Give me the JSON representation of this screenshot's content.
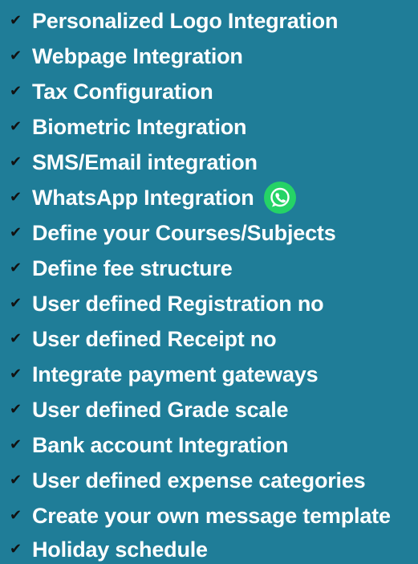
{
  "colors": {
    "background": "#1f7d98",
    "text": "#ffffff",
    "check": "#111111",
    "whatsapp_green": "#25d366"
  },
  "icons": {
    "bullet": "check-icon",
    "whatsapp": "whatsapp-icon"
  },
  "features": [
    {
      "label": "Personalized Logo Integration"
    },
    {
      "label": "Webpage Integration"
    },
    {
      "label": "Tax Configuration"
    },
    {
      "label": "Biometric Integration"
    },
    {
      "label": "SMS/Email integration"
    },
    {
      "label": "WhatsApp Integration"
    },
    {
      "label": "Define your Courses/Subjects"
    },
    {
      "label": "Define fee structure"
    },
    {
      "label": "User defined Registration no"
    },
    {
      "label": "User defined Receipt no"
    },
    {
      "label": "Integrate payment gateways"
    },
    {
      "label": "User defined Grade scale"
    },
    {
      "label": "Bank account Integration"
    },
    {
      "label": "User defined expense categories"
    },
    {
      "label": "Create your own message template"
    },
    {
      "label": "Holiday schedule"
    }
  ]
}
